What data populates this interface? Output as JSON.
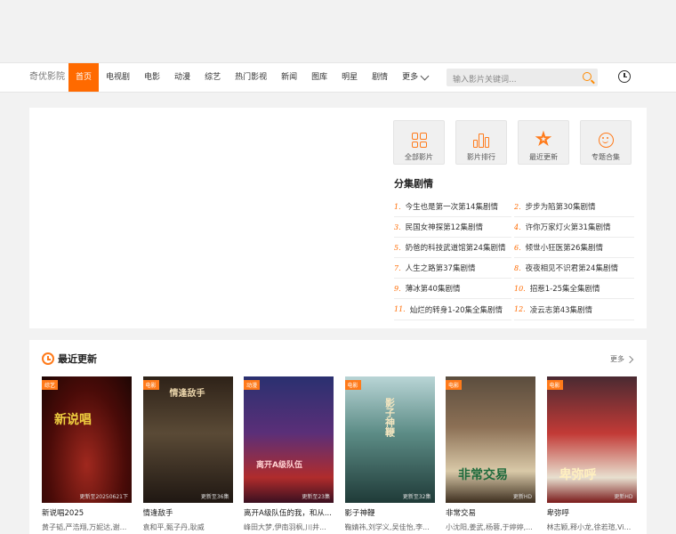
{
  "site": {
    "logo": "奇优影院"
  },
  "nav": {
    "items": [
      "首页",
      "电视剧",
      "电影",
      "动漫",
      "综艺",
      "热门影视",
      "新闻",
      "图库",
      "明星",
      "剧情"
    ],
    "more": "更多"
  },
  "search": {
    "placeholder": "输入影片关键词..."
  },
  "quick_links": [
    "全部影片",
    "影片排行",
    "最近更新",
    "专题合集"
  ],
  "episodes": {
    "title": "分集剧情",
    "items": [
      {
        "num": "1.",
        "text": "今生也是第一次第14集剧情"
      },
      {
        "num": "2.",
        "text": "步步为陷第30集剧情"
      },
      {
        "num": "3.",
        "text": "民国女神探第12集剧情"
      },
      {
        "num": "4.",
        "text": "许你万家灯火第31集剧情"
      },
      {
        "num": "5.",
        "text": "奶爸的科技武道馆第24集剧情"
      },
      {
        "num": "6.",
        "text": "倾世小狂医第26集剧情"
      },
      {
        "num": "7.",
        "text": "人生之路第37集剧情"
      },
      {
        "num": "8.",
        "text": "夜夜相见不识君第24集剧情"
      },
      {
        "num": "9.",
        "text": "薄冰第40集剧情"
      },
      {
        "num": "10.",
        "text": "招惹1-25集全集剧情"
      },
      {
        "num": "11.",
        "text": "灿烂的转身1-20集全集剧情"
      },
      {
        "num": "12.",
        "text": "凌云志第43集剧情"
      }
    ]
  },
  "recent": {
    "title": "最近更新",
    "more": "更多",
    "cards": [
      {
        "tag": "综艺",
        "note": "更新至20250621下",
        "poster_text": "新说唱",
        "title": "新说唱2025",
        "cast": "黄子韬,严浩翔,万妮达,谢..."
      },
      {
        "tag": "电影",
        "note": "更新至36集",
        "poster_text": "情逢敌手",
        "title": "情逢敌手",
        "cast": "袁和平,甄子丹,耿威"
      },
      {
        "tag": "动漫",
        "note": "更新至23集",
        "poster_text": "离开A级队伍",
        "title": "离开A级队伍的我，和从...",
        "cast": "峰田大梦,伊南羽枫,川井..."
      },
      {
        "tag": "电影",
        "note": "更新至32集",
        "poster_text": "影子神鞭",
        "title": "影子神鞭",
        "cast": "鞠婧祎,刘学义,吴佳怡,李..."
      },
      {
        "tag": "电影",
        "note": "更新HD",
        "poster_text": "非常交易",
        "title": "非常交易",
        "cast": "小沈阳,姜武,杨蓉,于婷婷,..."
      },
      {
        "tag": "电影",
        "note": "更新HD",
        "poster_text": "卑弥呼",
        "title": "卑弥呼",
        "cast": "林志颖,释小龙,徐若瑄,Vi..."
      }
    ]
  },
  "colors": {
    "accent": "#ff6a00",
    "background": "#f2f2f2"
  }
}
